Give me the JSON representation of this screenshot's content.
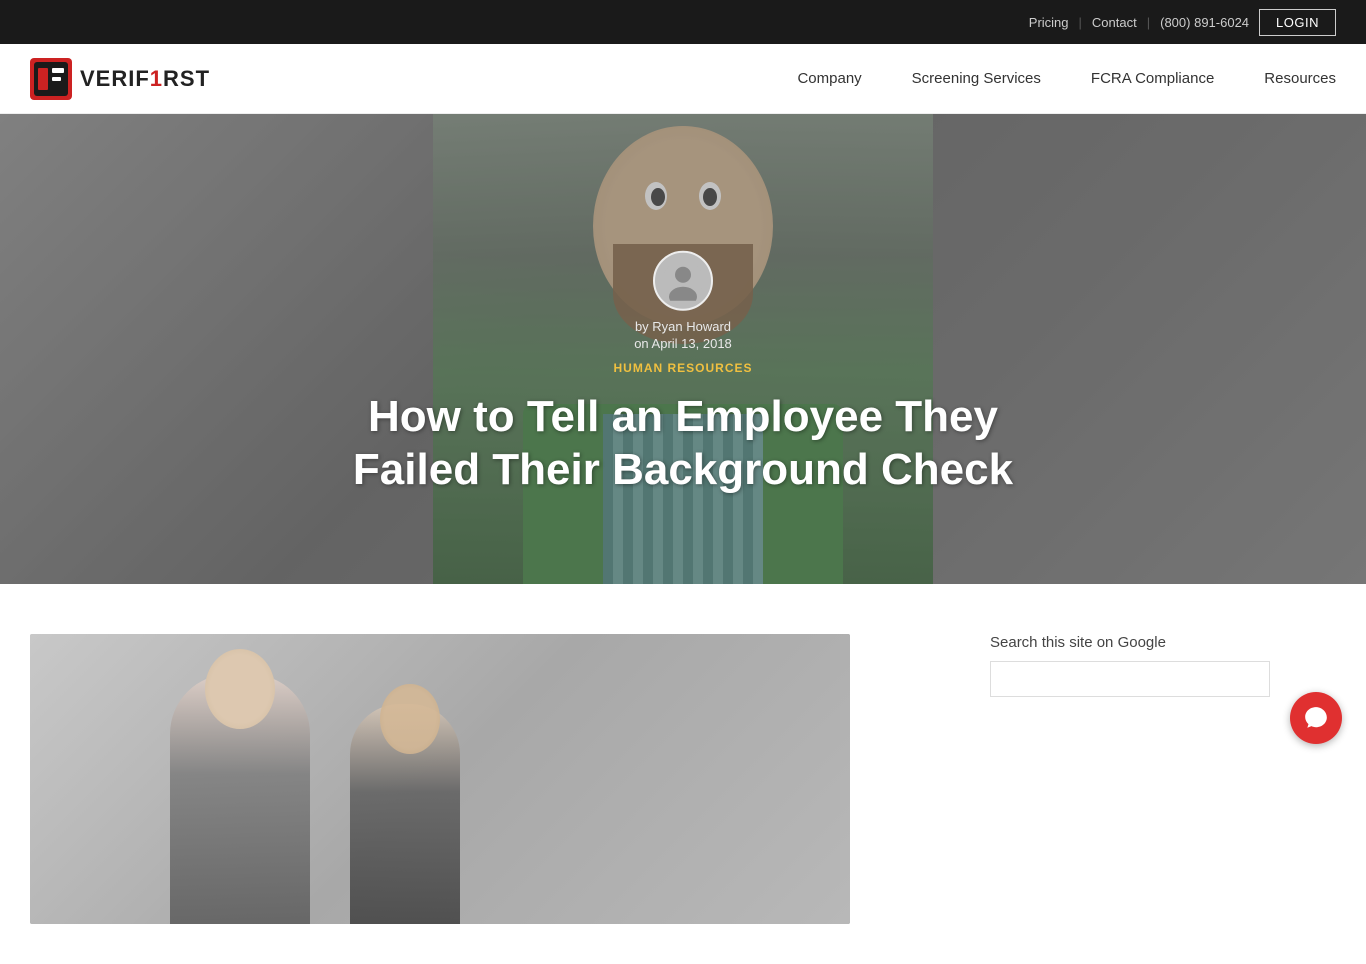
{
  "topbar": {
    "pricing_label": "Pricing",
    "separator1": "|",
    "contact_label": "Contact",
    "separator2": "|",
    "phone": "(800) 891-6024",
    "login_label": "LOGIN"
  },
  "nav": {
    "logo_text_part1": "VERIF",
    "logo_text_part2": "1",
    "logo_text_part3": "RST",
    "items": [
      {
        "label": "Company",
        "id": "company"
      },
      {
        "label": "Screening Services",
        "id": "screening-services"
      },
      {
        "label": "FCRA Compliance",
        "id": "fcra-compliance"
      },
      {
        "label": "Resources",
        "id": "resources"
      }
    ]
  },
  "hero": {
    "author_by": "by Ryan Howard",
    "author_date": "on April 13, 2018",
    "category": "Human Resources",
    "title_line1": "How to Tell an Employee They",
    "title_line2": "Failed Their Background Check"
  },
  "sidebar": {
    "search_label": "Search this site on Google",
    "search_placeholder": ""
  }
}
